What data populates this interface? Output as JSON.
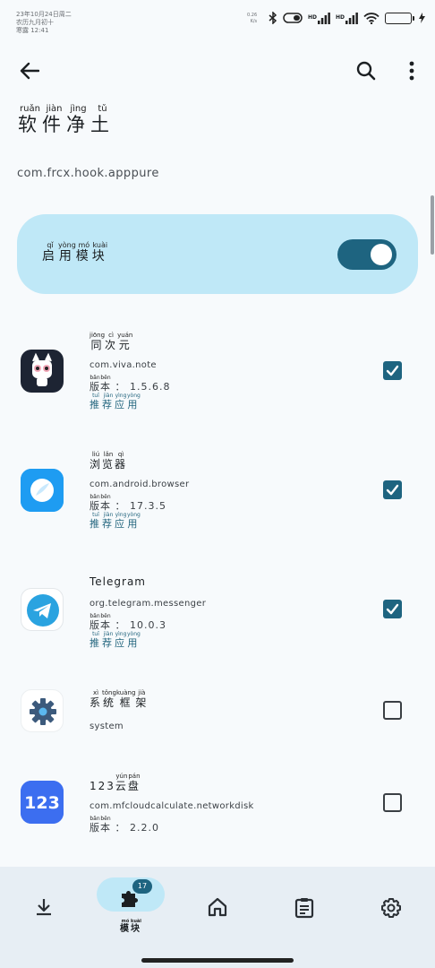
{
  "status_bar": {
    "date_line1": "23年10月24日周二",
    "date_line2": "农历九月初十",
    "date_line3": "寒露 12:41",
    "speed_top": "0.26",
    "speed_bottom": "K/s",
    "hd_label": "HD",
    "battery_percent": 100
  },
  "toolbar": {
    "back_icon": "arrow-back-icon",
    "search_icon": "search-icon",
    "more_icon": "more-vert-icon"
  },
  "header": {
    "title_chars": [
      {
        "char": "软",
        "pinyin": "ruǎn"
      },
      {
        "char": "件",
        "pinyin": "jiàn"
      },
      {
        "char": "净",
        "pinyin": "jìng"
      },
      {
        "char": "土",
        "pinyin": "tǔ"
      }
    ],
    "package": "com.frcx.hook.apppure"
  },
  "enable": {
    "label_chars": [
      {
        "char": "启",
        "pinyin": "qǐ"
      },
      {
        "char": "用",
        "pinyin": "yòng"
      },
      {
        "char": "模",
        "pinyin": "mó"
      },
      {
        "char": "块",
        "pinyin": "kuài"
      }
    ],
    "enabled": true
  },
  "apps": [
    {
      "name_chars": [
        {
          "char": "同",
          "pinyin": "jiōng"
        },
        {
          "char": "次",
          "pinyin": "cì"
        },
        {
          "char": "元",
          "pinyin": "yuán"
        }
      ],
      "package": "com.viva.note",
      "version_label": [
        {
          "char": "版",
          "pinyin": "bǎn"
        },
        {
          "char": "本",
          "pinyin": "běn"
        }
      ],
      "version": "： 1.5.6.8",
      "recommended": [
        {
          "char": "推",
          "pinyin": "tuī"
        },
        {
          "char": "荐",
          "pinyin": "jiàn"
        },
        {
          "char": "应",
          "pinyin": "yìng"
        },
        {
          "char": "用",
          "pinyin": "yòng"
        }
      ],
      "checked": true,
      "icon": "anime-bunny-icon"
    },
    {
      "name_chars": [
        {
          "char": "浏",
          "pinyin": "liú"
        },
        {
          "char": "览",
          "pinyin": "lǎn"
        },
        {
          "char": "器",
          "pinyin": "qì"
        }
      ],
      "package": "com.android.browser",
      "version_label": [
        {
          "char": "版",
          "pinyin": "bǎn"
        },
        {
          "char": "本",
          "pinyin": "běn"
        }
      ],
      "version": "： 17.3.5",
      "recommended": [
        {
          "char": "推",
          "pinyin": "tuī"
        },
        {
          "char": "荐",
          "pinyin": "jiàn"
        },
        {
          "char": "应",
          "pinyin": "yìng"
        },
        {
          "char": "用",
          "pinyin": "yòng"
        }
      ],
      "checked": true,
      "icon": "browser-icon"
    },
    {
      "name_text": "Telegram",
      "package": "org.telegram.messenger",
      "version_label": [
        {
          "char": "版",
          "pinyin": "bǎn"
        },
        {
          "char": "本",
          "pinyin": "běn"
        }
      ],
      "version": "： 10.0.3",
      "recommended": [
        {
          "char": "推",
          "pinyin": "tuī"
        },
        {
          "char": "荐",
          "pinyin": "jiàn"
        },
        {
          "char": "应",
          "pinyin": "yìng"
        },
        {
          "char": "用",
          "pinyin": "yòng"
        }
      ],
      "checked": true,
      "icon": "telegram-icon"
    },
    {
      "name_chars": [
        {
          "char": "系",
          "pinyin": "xì"
        },
        {
          "char": "统",
          "pinyin": "tǒng"
        },
        {
          "char": "框",
          "pinyin": "kuàng"
        },
        {
          "char": "架",
          "pinyin": "jià"
        }
      ],
      "package": "system",
      "checked": false,
      "icon": "system-gear-icon"
    },
    {
      "name_prefix": "123",
      "name_chars": [
        {
          "char": "云",
          "pinyin": "yún"
        },
        {
          "char": "盘",
          "pinyin": "pán"
        }
      ],
      "package": "com.mfcloudcalculate.networkdisk",
      "version_label": [
        {
          "char": "版",
          "pinyin": "bǎn"
        },
        {
          "char": "本",
          "pinyin": "běn"
        }
      ],
      "version": "： 2.2.0",
      "checked": false,
      "icon": "cloud-123-icon",
      "icon_text": "123"
    }
  ],
  "bottom_nav": {
    "items": [
      "download-icon",
      "puzzle-icon",
      "home-icon",
      "clipboard-icon",
      "settings-icon"
    ],
    "active_label": [
      {
        "char": "模",
        "pinyin": "mó"
      },
      {
        "char": "块",
        "pinyin": "kuài"
      }
    ],
    "badge": "17"
  },
  "colors": {
    "accent": "#1e6480",
    "card": "#bfe8f7",
    "nav_bg": "#e7eef4",
    "background": "#f7fafc"
  }
}
